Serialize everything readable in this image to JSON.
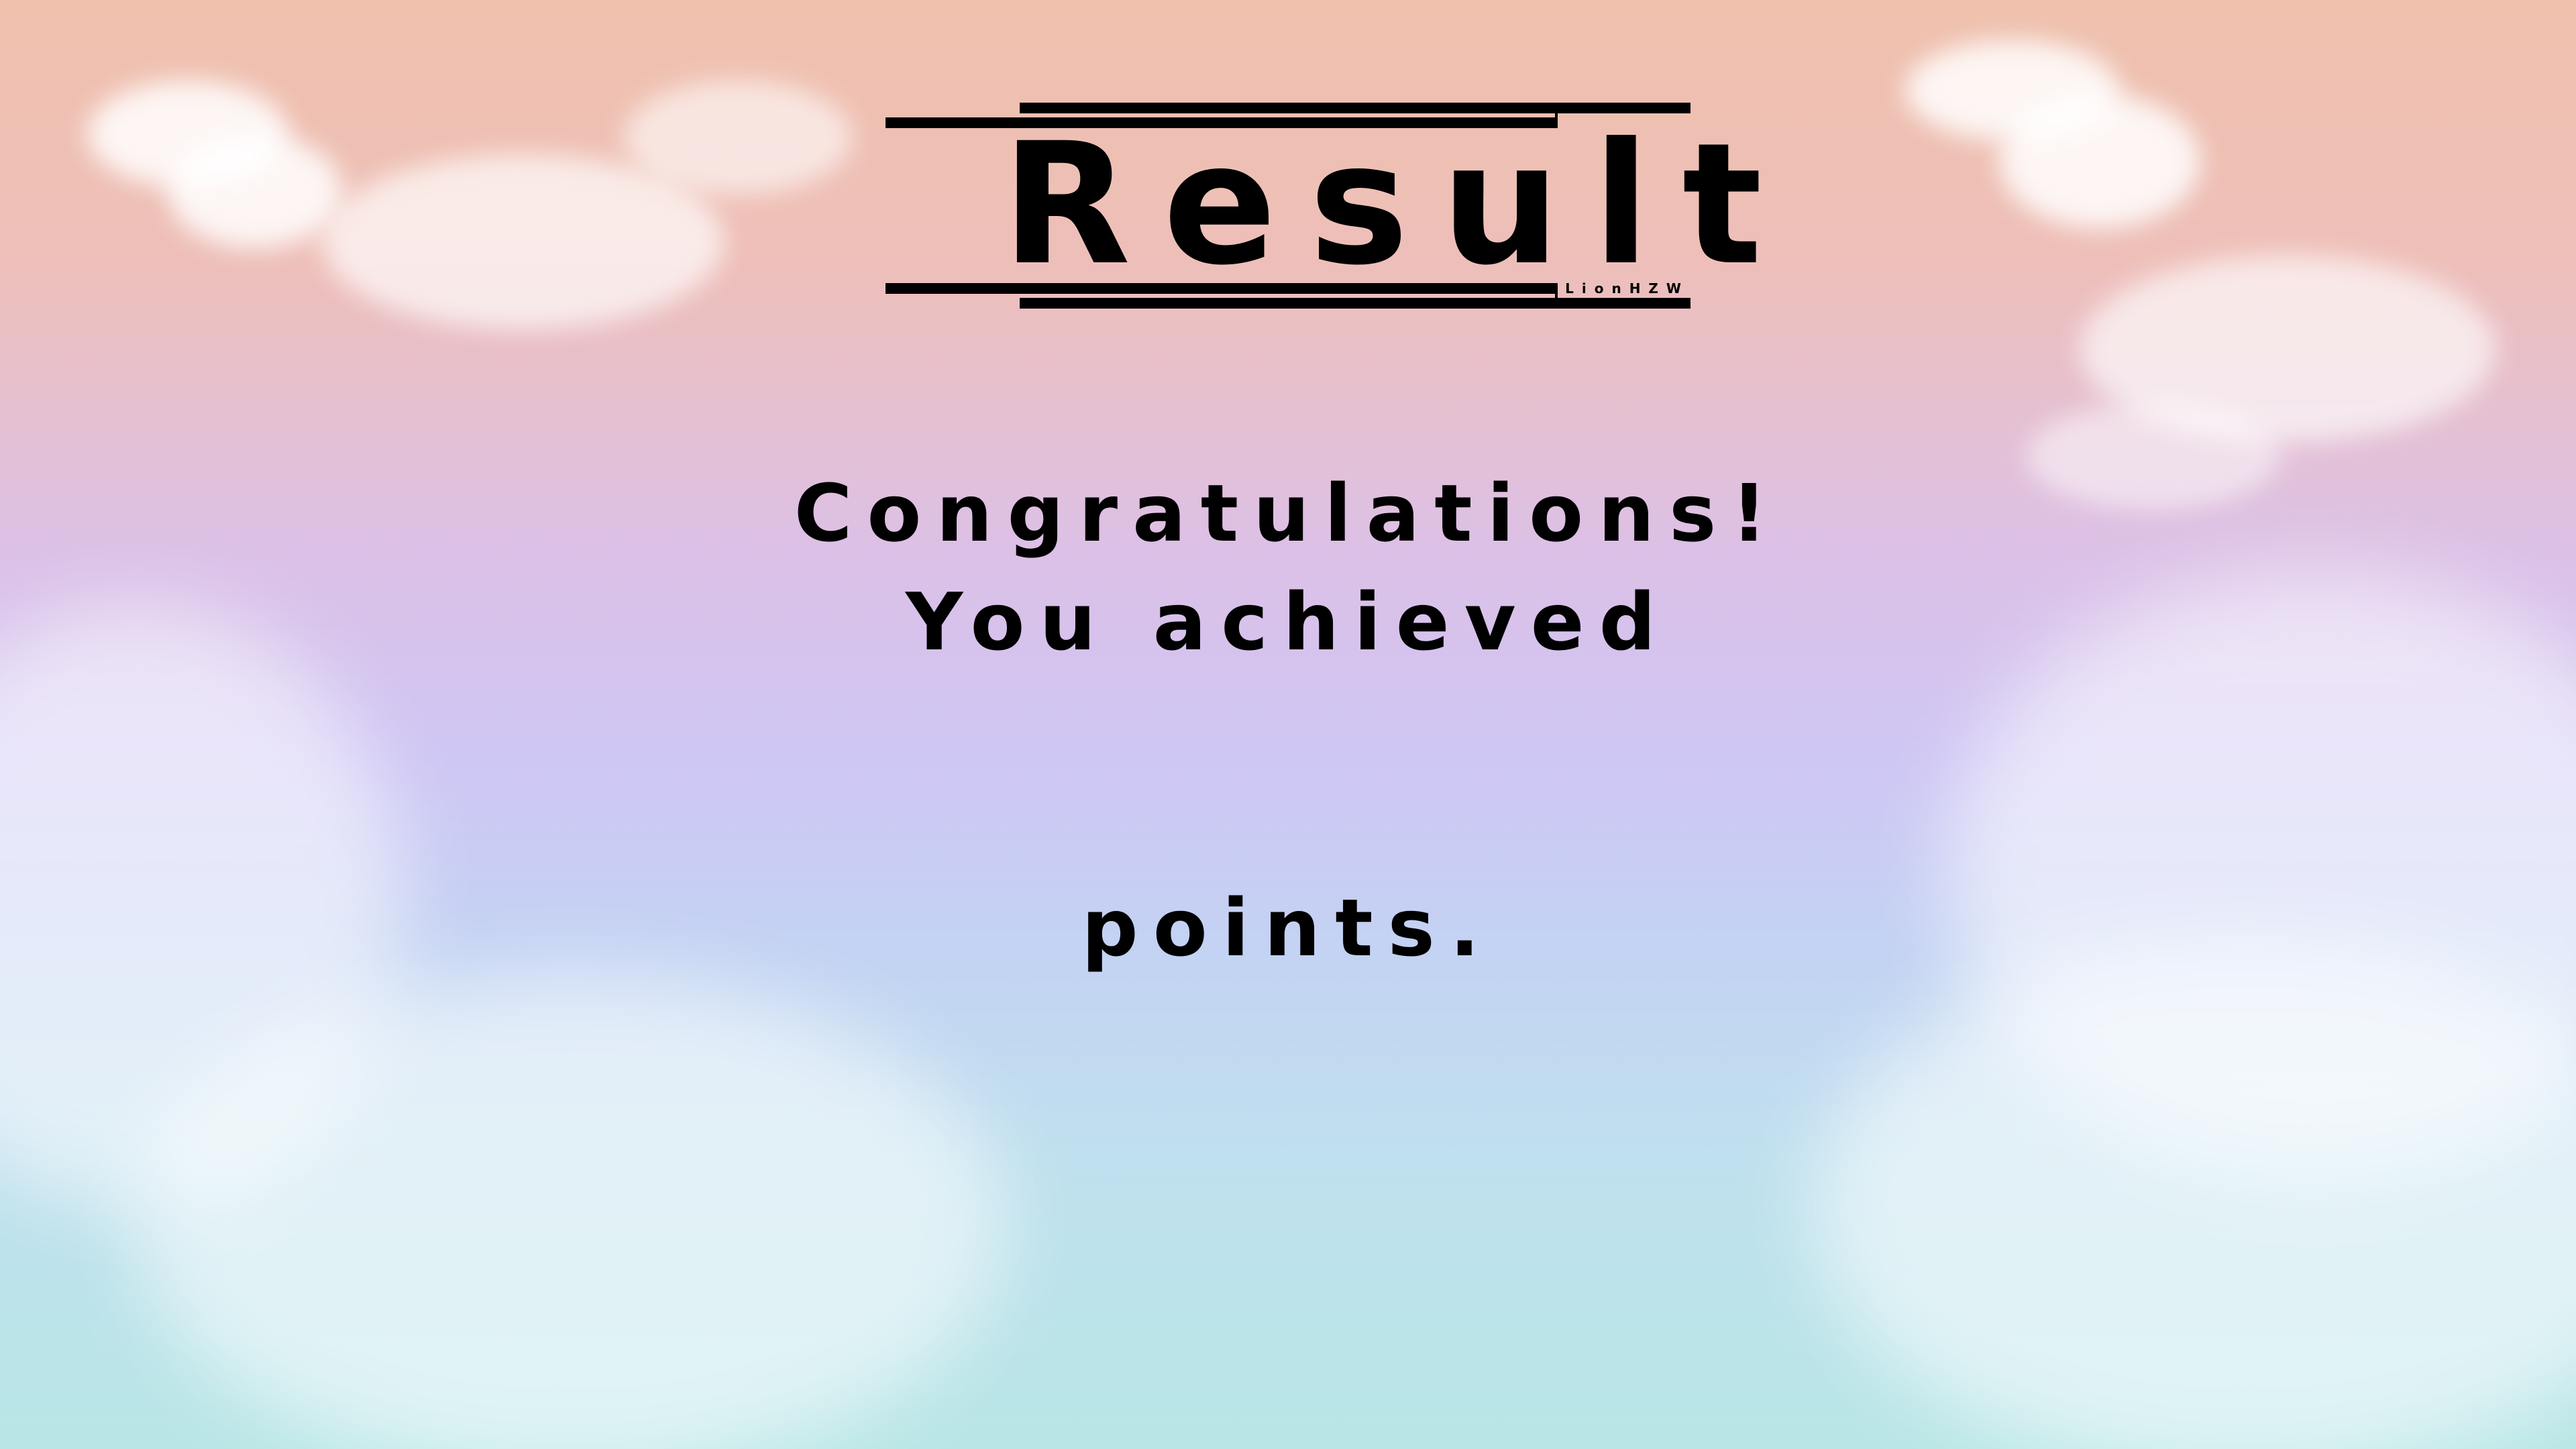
{
  "screen": {
    "title": "Result",
    "signature": "LionHZW",
    "congratulations": "Congratulations!",
    "achieved": "You achieved",
    "points_label": "points."
  },
  "colors": {
    "text": "#000000",
    "sky_top": "#efc1ad",
    "sky_mid": "#cfc6f4",
    "sky_bottom": "#b8e6e6"
  }
}
